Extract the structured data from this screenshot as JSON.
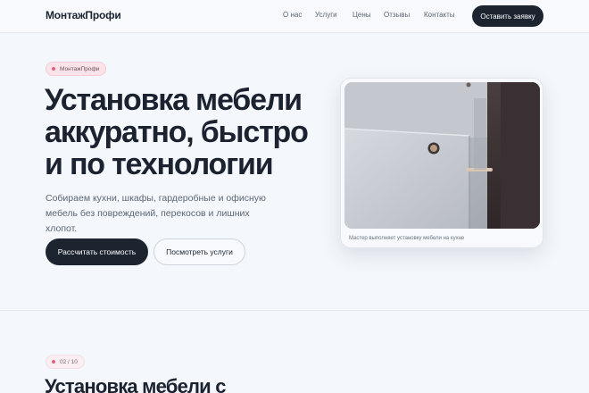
{
  "header": {
    "logo": "МонтажПрофи",
    "nav": [
      "О нас",
      "Услуги",
      "Цены",
      "Отзывы",
      "Контакты"
    ],
    "cta_label": "Оставить заявку"
  },
  "hero": {
    "chip": "МонтажПрофи",
    "title_lines": [
      "Установка мебели",
      "аккуратно, быстро",
      "и по технологии"
    ],
    "subtitle_lines": [
      "Собираем кухни, шкафы, гардеробные и офисную",
      "мебель без повреждений, перекосов и лишних хлопот."
    ],
    "primary_button": "Рассчитать стоимость",
    "secondary_button": "Посмотреть услуги"
  },
  "photo_card": {
    "caption": "Мастер выполняет установку мебели на кухне"
  },
  "next_section": {
    "counter": "02 / 10",
    "title": "Установка мебели с"
  },
  "colors": {
    "background": "#f4f7fb",
    "dark_button": "#1c2430",
    "chip_dot": "#e0647f",
    "chip_bg": "#fbe3e9",
    "text_muted": "#5c6675"
  }
}
